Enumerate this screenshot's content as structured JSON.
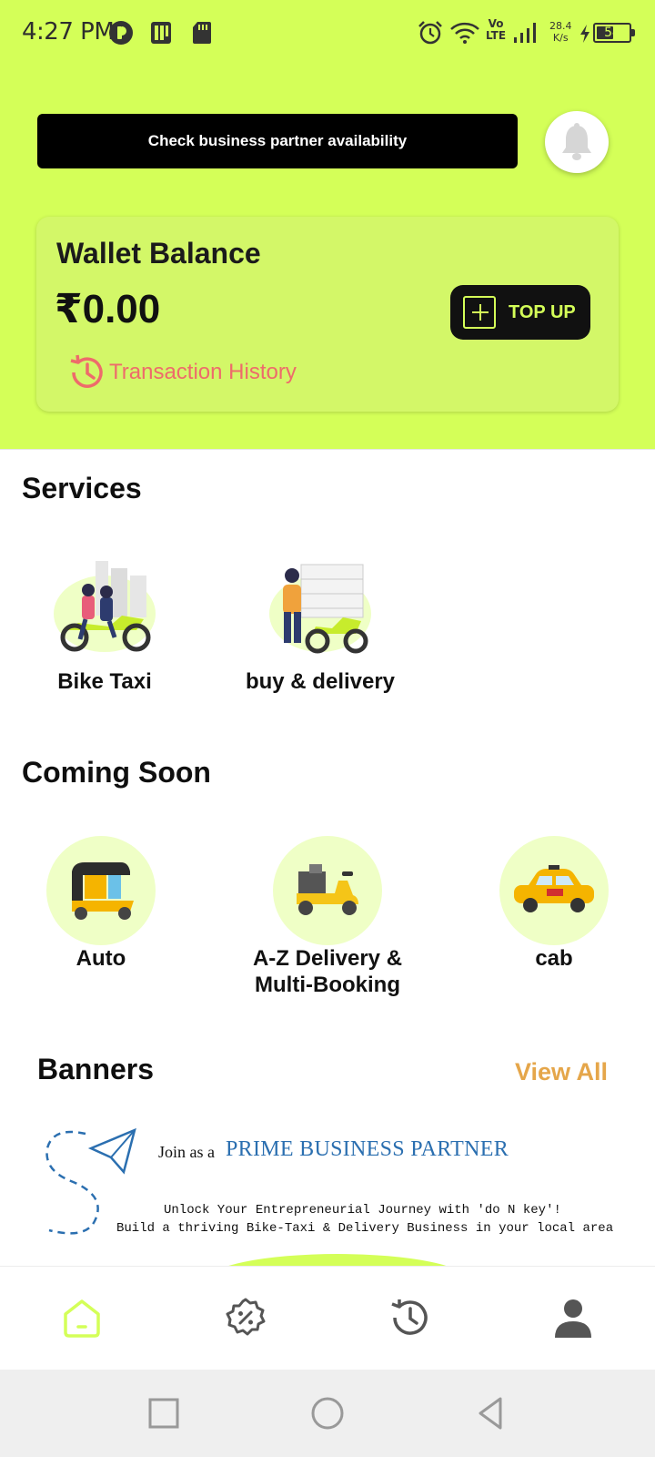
{
  "status_bar": {
    "time": "4:27 PM",
    "network_speed": "28.4",
    "network_speed_unit": "K/s",
    "battery": "54",
    "battery_level": 0.54,
    "signal_label": "Vo LTE"
  },
  "header": {
    "check_button_label": "Check business partner availability"
  },
  "wallet": {
    "title": "Wallet Balance",
    "amount": "₹0.00",
    "top_up_label": "TOP UP",
    "history_label": "Transaction History"
  },
  "services": {
    "title": "Services",
    "items": [
      {
        "label": "Bike Taxi"
      },
      {
        "label": "buy & delivery"
      }
    ]
  },
  "coming_soon": {
    "title": "Coming Soon",
    "items": [
      {
        "label": "Auto"
      },
      {
        "label": "A-Z Delivery &\nMulti-Booking"
      },
      {
        "label": "cab"
      }
    ]
  },
  "banners": {
    "title": "Banners",
    "view_all_label": "View All",
    "banner": {
      "join_text": "Join as a",
      "highlight": "PRIME BUSINESS PARTNER",
      "tagline_1": "Unlock Your Entrepreneurial Journey with 'do N key'!",
      "tagline_2": "Build a thriving Bike-Taxi & Delivery Business in your local area"
    }
  },
  "bottom_nav": {
    "items": [
      {
        "icon": "home-icon",
        "active": true
      },
      {
        "icon": "offers-icon",
        "active": false
      },
      {
        "icon": "history-icon",
        "active": false
      },
      {
        "icon": "profile-icon",
        "active": false
      }
    ]
  },
  "colors": {
    "brand": "#d4ff58",
    "accent_orange": "#e5a64a",
    "history_red": "#ee6b6b",
    "banner_blue": "#2b6fb0"
  }
}
